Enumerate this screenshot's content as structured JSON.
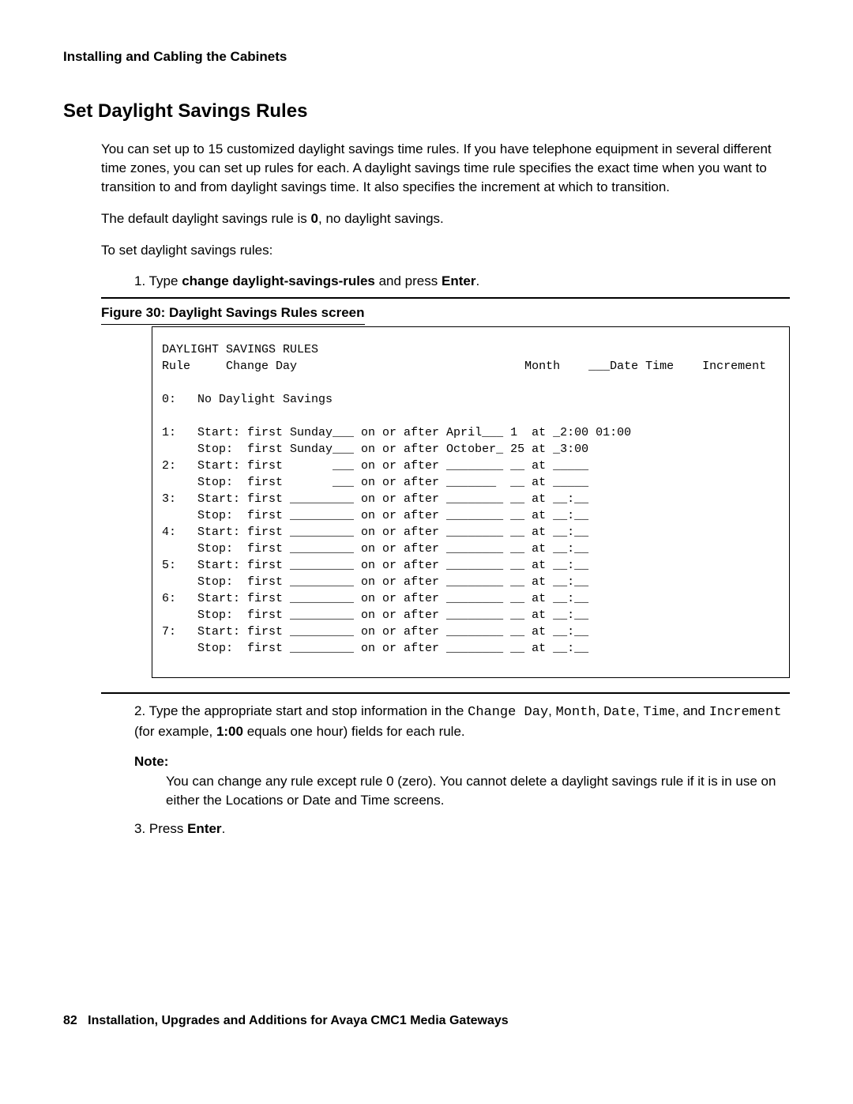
{
  "header": "Installing and Cabling the Cabinets",
  "title": "Set Daylight Savings Rules",
  "para1": "You can set up to 15 customized daylight savings time rules. If you have telephone equipment in several different time zones, you can set up rules for each. A daylight savings time rule specifies the exact time when you want to transition to and from daylight savings time. It also specifies the increment at which to transition.",
  "para2_a": "The default daylight savings rule is ",
  "para2_b_bold": "0",
  "para2_c": ", no daylight savings.",
  "para3": "To set daylight savings rules:",
  "step1_a": "1. Type ",
  "step1_b_bold": "change daylight-savings-rules",
  "step1_c": " and press ",
  "step1_d_bold": "Enter",
  "step1_e": ".",
  "figure_caption": "Figure 30: Daylight Savings Rules screen",
  "screen_text": "DAYLIGHT SAVINGS RULES\nRule     Change Day                                Month    ___Date Time    Increment\n\n0:   No Daylight Savings\n\n1:   Start: first Sunday___ on or after April___ 1  at _2:00 01:00\n     Stop:  first Sunday___ on or after October_ 25 at _3:00\n2:   Start: first       ___ on or after ________ __ at _____\n     Stop:  first       ___ on or after _______  __ at _____\n3:   Start: first _________ on or after ________ __ at __:__\n     Stop:  first _________ on or after ________ __ at __:__\n4:   Start: first _________ on or after ________ __ at __:__\n     Stop:  first _________ on or after ________ __ at __:__\n5:   Start: first _________ on or after ________ __ at __:__\n     Stop:  first _________ on or after ________ __ at __:__\n6:   Start: first _________ on or after ________ __ at __:__\n     Stop:  first _________ on or after ________ __ at __:__\n7:   Start: first _________ on or after ________ __ at __:__\n     Stop:  first _________ on or after ________ __ at __:__",
  "step2_a": "2. Type the appropriate start and stop information in the ",
  "step2_m1": "Change Day",
  "step2_b": ", ",
  "step2_m2": "Month",
  "step2_c": ", ",
  "step2_m3": "Date",
  "step2_d": ", ",
  "step2_m4": "Time",
  "step2_e": ", and ",
  "step2_m5": "Increment",
  "step2_f": " (for example, ",
  "step2_bold": "1:00",
  "step2_g": " equals one hour) fields for each rule.",
  "note_label": "Note:",
  "note_body": "You can change any rule except rule 0 (zero). You cannot delete a daylight savings rule if it is in use on either the Locations or Date and Time screens.",
  "step3_a": "3. Press ",
  "step3_b_bold": "Enter",
  "step3_c": ".",
  "footer_page": "82",
  "footer_text": "Installation, Upgrades and Additions for Avaya CMC1 Media Gateways"
}
